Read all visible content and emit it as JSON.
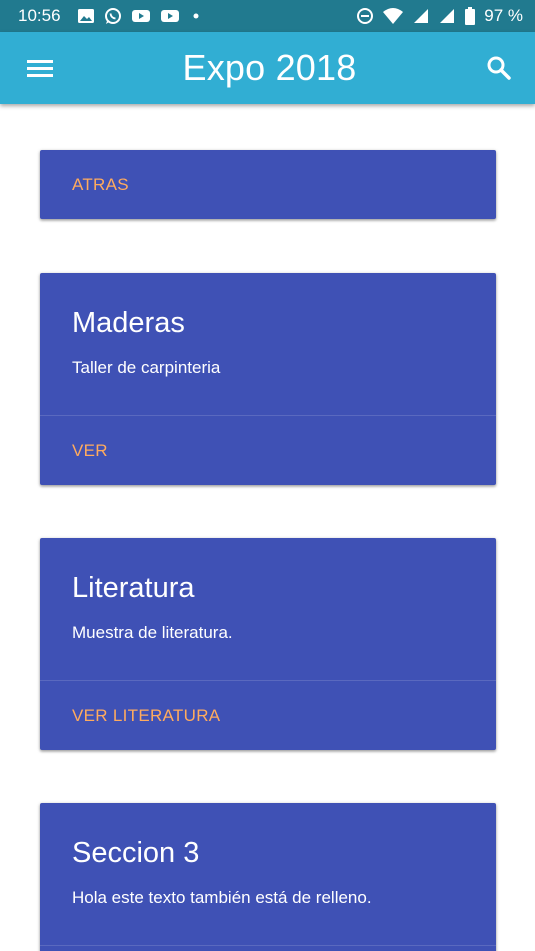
{
  "status_bar": {
    "time": "10:56",
    "battery_text": "97 %",
    "notification_icons": [
      "image-icon",
      "whatsapp-icon",
      "youtube-icon",
      "youtube-icon",
      "dot-icon"
    ],
    "system_icons": [
      "dnd-icon",
      "wifi-icon",
      "signal-icon",
      "signal-icon",
      "battery-icon"
    ]
  },
  "app_bar": {
    "title": "Expo 2018",
    "menu_icon": "menu-icon",
    "search_icon": "search-icon"
  },
  "cards": [
    {
      "action": "ATRAS"
    },
    {
      "title": "Maderas",
      "text": "Taller de carpinteria",
      "action": "VER"
    },
    {
      "title": "Literatura",
      "text": "Muestra de literatura.",
      "action": "VER LITERATURA"
    },
    {
      "title": "Seccion 3",
      "text": "Hola este texto también está de relleno."
    }
  ],
  "colors": {
    "status_bar": "#217a8f",
    "app_bar": "#31aed3",
    "card": "#3f51b5",
    "action_text": "#ffab5e"
  }
}
